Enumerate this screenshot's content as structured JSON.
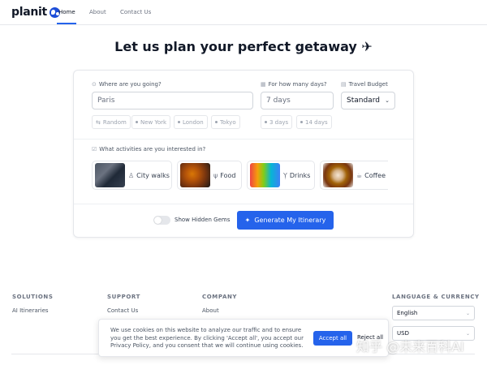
{
  "header": {
    "logo_text": "planit",
    "nav": [
      {
        "label": "Home",
        "active": true
      },
      {
        "label": "About",
        "active": false
      },
      {
        "label": "Contact Us",
        "active": false
      }
    ]
  },
  "hero": {
    "title": "Let us plan your perfect getaway ✈"
  },
  "form": {
    "destination": {
      "label": "Where are you going?",
      "placeholder": "Paris",
      "suggestions": [
        "Random",
        "New York",
        "London",
        "Tokyo"
      ]
    },
    "days": {
      "label": "For how many days?",
      "placeholder": "7 days",
      "suggestions": [
        "3 days",
        "14 days"
      ]
    },
    "budget": {
      "label": "Travel Budget",
      "value": "Standard"
    },
    "activities": {
      "label": "What activities are you interested in?",
      "items": [
        {
          "label": "City walks",
          "icon": "walking-icon"
        },
        {
          "label": "Food",
          "icon": "fork-icon"
        },
        {
          "label": "Drinks",
          "icon": "cocktail-icon"
        },
        {
          "label": "Coffee",
          "icon": "coffee-icon"
        }
      ]
    },
    "hidden_gems": {
      "label": "Show Hidden Gems",
      "enabled": false
    },
    "generate_button": "Generate My Itinerary"
  },
  "footer": {
    "solutions": {
      "heading": "SOLUTIONS",
      "links": [
        "AI Itineraries"
      ]
    },
    "support": {
      "heading": "SUPPORT",
      "links": [
        "Contact Us"
      ]
    },
    "company": {
      "heading": "COMPANY",
      "links": [
        "About"
      ]
    },
    "language_currency": {
      "heading": "LANGUAGE & CURRENCY",
      "language": "English",
      "currency": "USD"
    }
  },
  "cookie_banner": {
    "text": "We use cookies on this website to analyze our traffic and to ensure you get the best experience. By clicking 'Accept all', you accept our Privacy Policy, and you consent that we will continue using cookies.",
    "accept": "Accept all",
    "reject": "Reject all"
  },
  "watermark": "知乎 @未来百科AI",
  "colors": {
    "accent": "#2563eb",
    "text": "#111827",
    "muted": "#6b7280",
    "border": "#e5e7eb"
  }
}
